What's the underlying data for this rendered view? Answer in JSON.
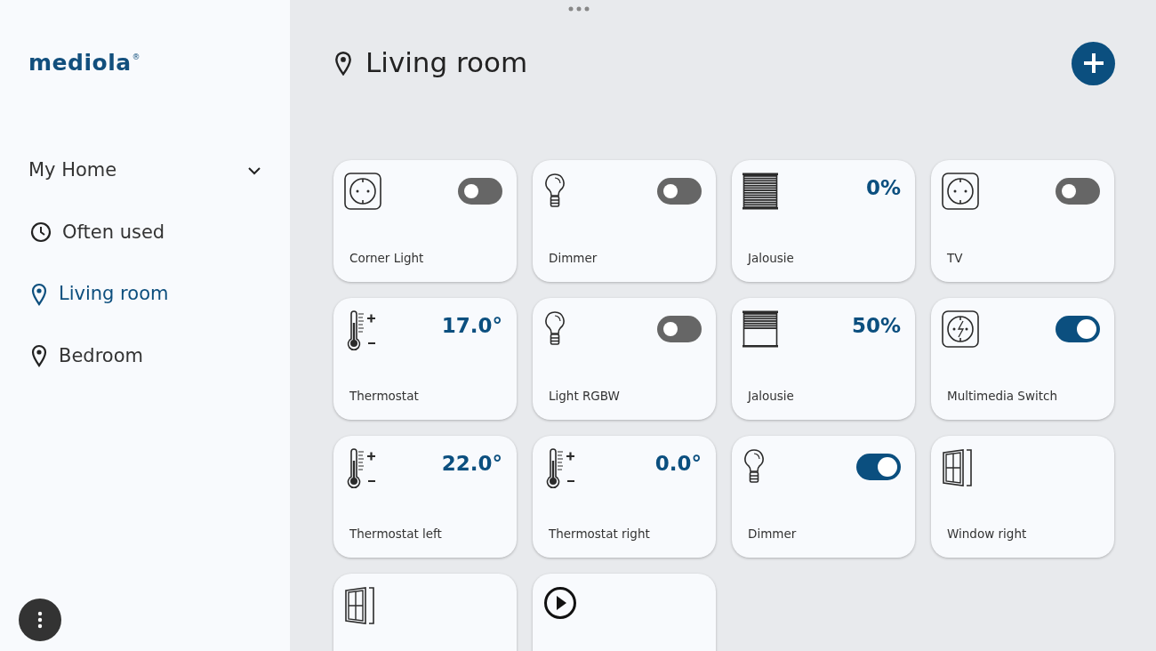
{
  "logo": {
    "text": "mediola",
    "mark": "®"
  },
  "sidebar": {
    "group": {
      "label": "My Home",
      "expanded": true
    },
    "items": [
      {
        "label": "Often used",
        "kind": "clock",
        "selected": false
      },
      {
        "label": "Living room",
        "kind": "pin",
        "selected": true
      },
      {
        "label": "Bedroom",
        "kind": "pin",
        "selected": false
      }
    ]
  },
  "page": {
    "title": "Living room"
  },
  "devices": [
    {
      "label": "Corner Light",
      "kind": "socket",
      "on": false
    },
    {
      "label": "Dimmer",
      "kind": "bulb",
      "on": false
    },
    {
      "label": "Jalousie",
      "kind": "blindclosed",
      "value": "0%"
    },
    {
      "label": "TV",
      "kind": "socket",
      "on": false
    },
    {
      "label": "Thermostat",
      "kind": "thermostat",
      "value": "17.0°"
    },
    {
      "label": "Light RGBW",
      "kind": "bulb",
      "on": false
    },
    {
      "label": "Jalousie",
      "kind": "blindhalf",
      "value": "50%"
    },
    {
      "label": "Multimedia Switch",
      "kind": "powersocket",
      "on": true
    },
    {
      "label": "Thermostat left",
      "kind": "thermostat",
      "value": "22.0°"
    },
    {
      "label": "Thermostat right",
      "kind": "thermostat",
      "value": "0.0°"
    },
    {
      "label": "Dimmer",
      "kind": "bulb",
      "on": true
    },
    {
      "label": "Window right",
      "kind": "window"
    },
    {
      "kind": "window"
    },
    {
      "kind": "play"
    }
  ]
}
